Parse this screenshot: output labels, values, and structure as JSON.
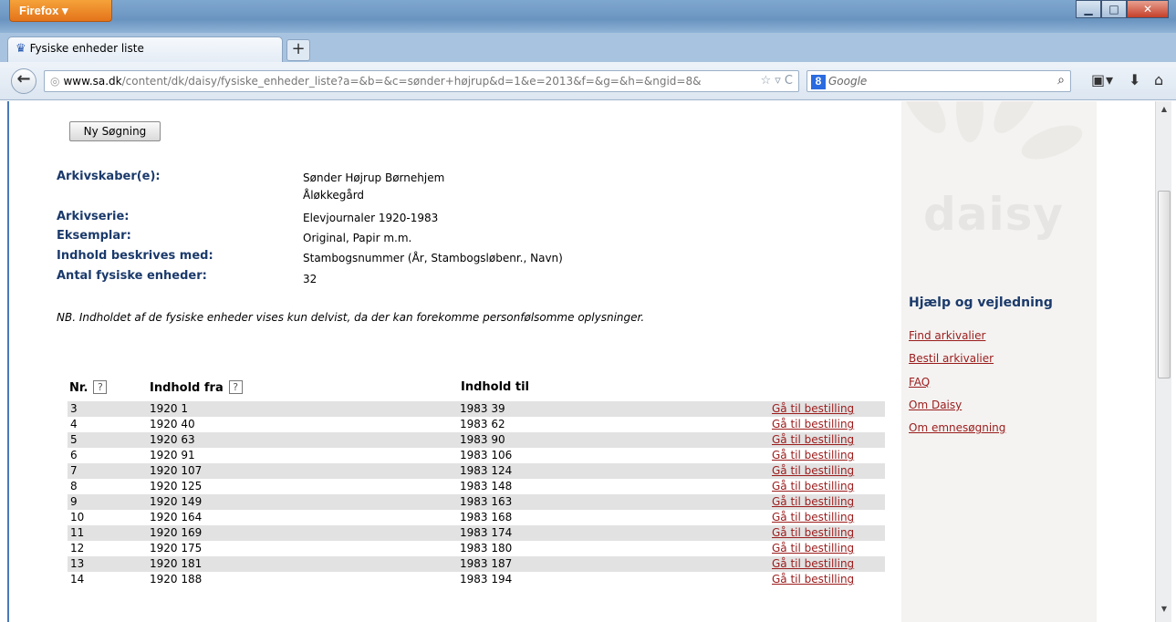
{
  "browser": {
    "menu_button": "Firefox ▾",
    "tab_title": "Fysiske enheder liste",
    "new_tab": "+",
    "url_domain": "www.sa.dk",
    "url_path": "/content/dk/daisy/fysiske_enheder_liste?a=&b=&c=sønder+højrup&d=1&e=2013&f=&g=&h=&ngid=8&",
    "search_placeholder": "Google"
  },
  "page": {
    "new_search_label": "Ny Søgning",
    "metadata": [
      {
        "label": "Arkivskaber(e):",
        "values": [
          "Sønder Højrup Børnehjem",
          "Åløkkegård"
        ]
      },
      {
        "label": "Arkivserie:",
        "values": [
          "Elevjournaler  1920-1983"
        ]
      },
      {
        "label": "Eksemplar:",
        "values": [
          "Original,  Papir m.m."
        ]
      },
      {
        "label": "Indhold beskrives med:",
        "values": [
          "Stambogsnummer (År, Stambogsløbenr., Navn)"
        ]
      },
      {
        "label": "Antal fysiske enheder:",
        "values": [
          "32"
        ]
      }
    ],
    "note": "NB. Indholdet af de fysiske enheder vises kun delvist, da der kan forekomme personfølsomme oplysninger.",
    "table": {
      "headers": {
        "nr": "Nr.",
        "from": "Indhold fra",
        "to": "Indhold til",
        "help": "?"
      },
      "rows": [
        {
          "nr": "3",
          "from": "1920 1",
          "to": "1983 39",
          "link": "Gå til bestilling"
        },
        {
          "nr": "4",
          "from": "1920 40",
          "to": "1983 62",
          "link": "Gå til bestilling"
        },
        {
          "nr": "5",
          "from": "1920 63",
          "to": "1983 90",
          "link": "Gå til bestilling"
        },
        {
          "nr": "6",
          "from": "1920 91",
          "to": "1983 106",
          "link": "Gå til bestilling"
        },
        {
          "nr": "7",
          "from": "1920 107",
          "to": "1983 124",
          "link": "Gå til bestilling"
        },
        {
          "nr": "8",
          "from": "1920 125",
          "to": "1983 148",
          "link": "Gå til bestilling"
        },
        {
          "nr": "9",
          "from": "1920 149",
          "to": "1983 163",
          "link": "Gå til bestilling"
        },
        {
          "nr": "10",
          "from": "1920 164",
          "to": "1983 168",
          "link": "Gå til bestilling"
        },
        {
          "nr": "11",
          "from": "1920 169",
          "to": "1983 174",
          "link": "Gå til bestilling"
        },
        {
          "nr": "12",
          "from": "1920 175",
          "to": "1983 180",
          "link": "Gå til bestilling"
        },
        {
          "nr": "13",
          "from": "1920 181",
          "to": "1983 187",
          "link": "Gå til bestilling"
        },
        {
          "nr": "14",
          "from": "1920 188",
          "to": "1983 194",
          "link": "Gå til bestilling"
        }
      ]
    }
  },
  "sidebar": {
    "logo": "daisy",
    "title": "Hjælp og vejledning",
    "links": [
      "Find arkivalier",
      "Bestil arkivalier",
      "FAQ",
      "Om Daisy",
      "Om emnesøgning"
    ]
  }
}
